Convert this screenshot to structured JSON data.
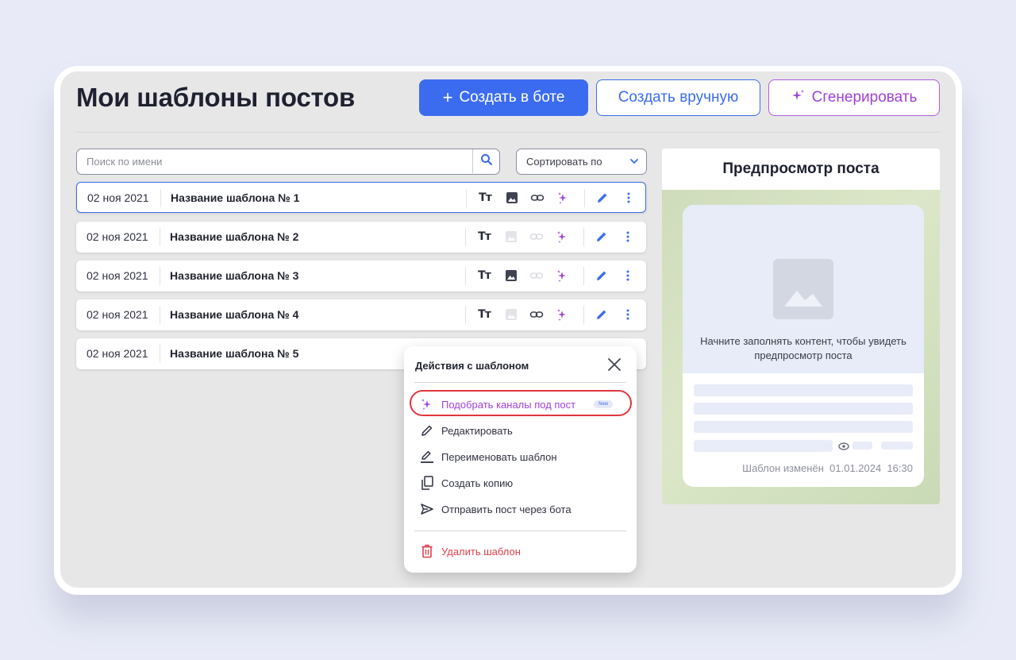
{
  "page": {
    "title": "Мои шаблоны постов"
  },
  "toolbar": {
    "create_bot_label": "Создать в боте",
    "create_bot_icon": "plus-icon",
    "create_manual_label": "Создать вручную",
    "generate_label": "Сгенерировать",
    "generate_icon": "sparkle-icon"
  },
  "search": {
    "placeholder": "Поиск по имени",
    "value": ""
  },
  "sort": {
    "label": "Сортировать по"
  },
  "templates": [
    {
      "date": "02 ноя 2021",
      "name": "Название шаблона № 1",
      "has_image": true,
      "has_link": true
    },
    {
      "date": "02 ноя 2021",
      "name": "Название шаблона № 2",
      "has_image": false,
      "has_link": false
    },
    {
      "date": "02 ноя 2021",
      "name": "Название шаблона № 3",
      "has_image": true,
      "has_link": false
    },
    {
      "date": "02 ноя 2021",
      "name": "Название шаблона № 4",
      "has_image": false,
      "has_link": true
    },
    {
      "date": "02 ноя 2021",
      "name": "Название шаблона № 5"
    }
  ],
  "row_icons": {
    "text": "Тт"
  },
  "preview": {
    "title": "Предпросмотр поста",
    "hint": "Начните заполнять контент, чтобы увидеть предпросмотр поста",
    "changed_label": "Шаблон изменён",
    "changed_date": "01.01.2024",
    "changed_time": "16:30"
  },
  "menu": {
    "title": "Действия с шаблоном",
    "items": [
      {
        "label": "Подобрать каналы под пост",
        "icon": "sparkle-icon",
        "badge": "New"
      },
      {
        "label": "Редактировать",
        "icon": "pencil-icon"
      },
      {
        "label": "Переименовать шаблон",
        "icon": "rename-icon"
      },
      {
        "label": "Создать копию",
        "icon": "copy-icon"
      },
      {
        "label": "Отправить пост через бота",
        "icon": "send-icon"
      }
    ],
    "delete_label": "Удалить шаблон"
  },
  "colors": {
    "accent_blue": "#3b6cf0",
    "accent_purple": "#a042d8",
    "danger": "#e0414d",
    "highlight": "#e2363d"
  }
}
